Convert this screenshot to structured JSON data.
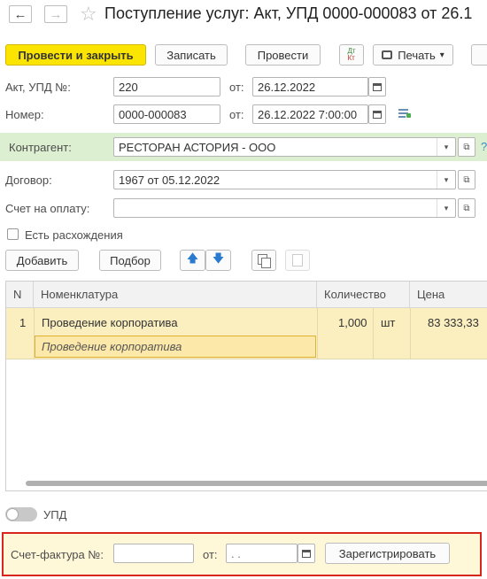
{
  "header": {
    "title": "Поступление услуг: Акт, УПД 0000-000083 от 26.1",
    "back_glyph": "←",
    "forward_glyph": "→",
    "star_glyph": "☆"
  },
  "toolbar": {
    "post_close": "Провести и закрыть",
    "save": "Записать",
    "post": "Провести",
    "dt_icon_top": "Дт",
    "dt_icon_bottom": "Кт",
    "print": "Печать",
    "print_arrow": "▾"
  },
  "form": {
    "act_label": "Акт, УПД №:",
    "act_value": "220",
    "from_label_1": "от:",
    "act_date": "26.12.2022",
    "number_label": "Номер:",
    "number_value": "0000-000083",
    "from_label_2": "от:",
    "number_date": "26.12.2022  7:00:00",
    "counterparty_label": "Контрагент:",
    "counterparty_value": "РЕСТОРАН АСТОРИЯ - ООО",
    "help_glyph": "?",
    "contract_label": "Договор:",
    "contract_value": "1967 от 05.12.2022",
    "invoice_pay_label": "Счет на оплату:",
    "invoice_pay_value": "",
    "discrepancy_label": "Есть расхождения",
    "dropdown_glyph": "▾",
    "open_glyph": "⧉"
  },
  "table_toolbar": {
    "add": "Добавить",
    "select": "Подбор",
    "up_glyph": "🡅",
    "down_glyph": "🡇"
  },
  "table": {
    "headers": [
      "N",
      "Номенклатура",
      "Количество",
      "Цена"
    ],
    "rows": [
      {
        "n": "1",
        "name": "Проведение корпоратива",
        "qty": "1,000",
        "unit": "шт",
        "price": "83 333,33",
        "content": "Проведение корпоратива"
      }
    ]
  },
  "upd": {
    "label": "УПД"
  },
  "invoice": {
    "label": "Счет-фактура №:",
    "number": "",
    "from_label": "от:",
    "date": "  .  .",
    "register": "Зарегистрировать"
  },
  "colors": {
    "accent_yellow": "#fbe500",
    "counterparty_bg": "#dcefd0",
    "selected_row": "#fbefc0",
    "highlight_border": "#d9261c"
  }
}
